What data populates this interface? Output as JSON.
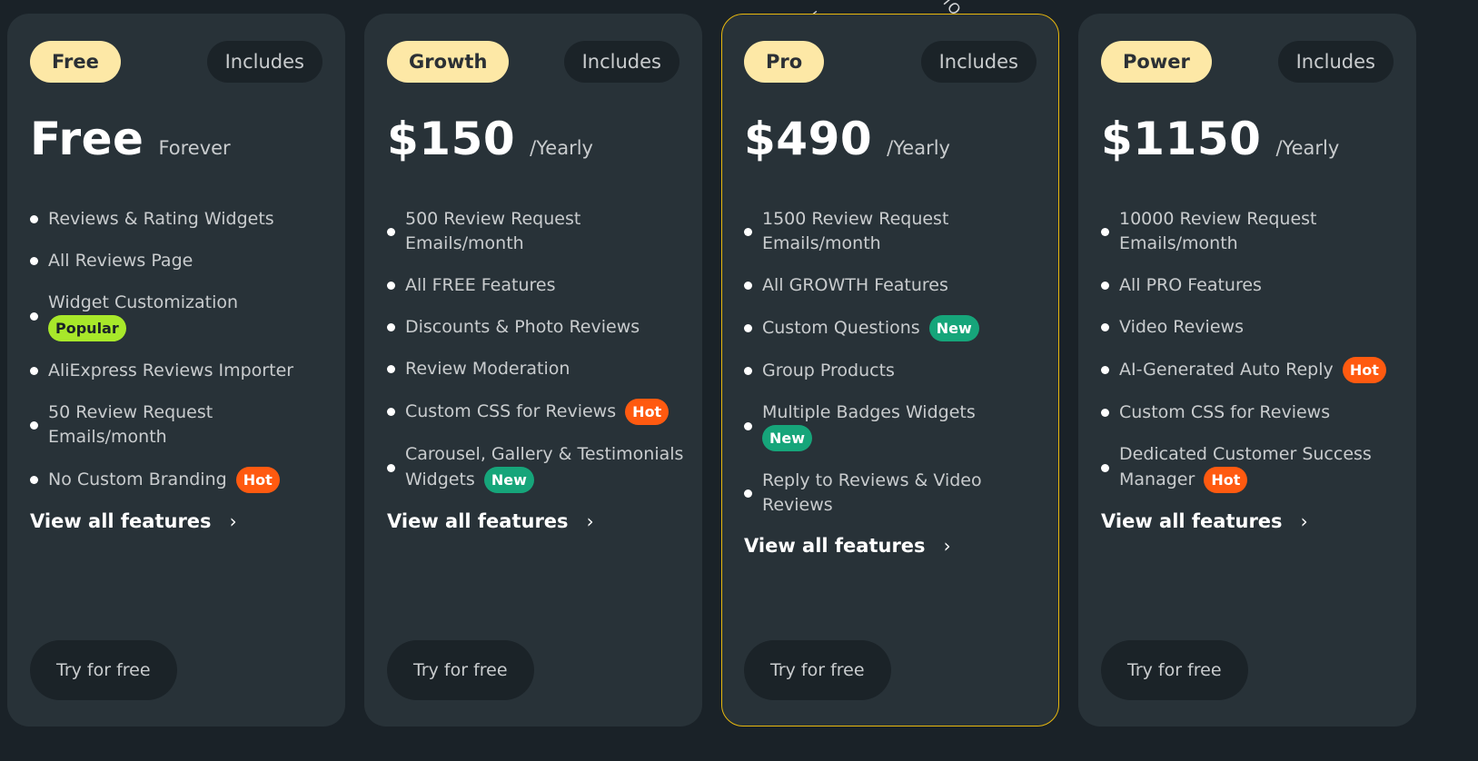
{
  "decor": {
    "arc_left": "T   ",
    "arc_right": "IO"
  },
  "colors": {
    "background": "#1a2228",
    "card": "#283238",
    "tier_badge": "#fde8a6",
    "featured_border": "#e8b80e",
    "tag_hot": "#ff5a10",
    "tag_new": "#16a57a",
    "tag_popular": "#a8e82a"
  },
  "plans": [
    {
      "tier": "Free",
      "includes_label": "Includes",
      "price": "Free",
      "period": "Forever",
      "featured": false,
      "features": [
        {
          "text": "Reviews & Rating Widgets",
          "tag": null
        },
        {
          "text": "All Reviews Page",
          "tag": null
        },
        {
          "text": "Widget Customization",
          "tag": "Popular"
        },
        {
          "text": "AliExpress Reviews Importer",
          "tag": null
        },
        {
          "text": "50 Review Request Emails/month",
          "tag": null
        },
        {
          "text": "No Custom Branding",
          "tag": "Hot"
        }
      ],
      "view_all_label": "View all features",
      "cta_label": "Try for free"
    },
    {
      "tier": "Growth",
      "includes_label": "Includes",
      "price": "$150",
      "period": "/Yearly",
      "featured": false,
      "features": [
        {
          "text": "500 Review Request Emails/month",
          "tag": null
        },
        {
          "text": "All FREE Features",
          "tag": null
        },
        {
          "text": "Discounts & Photo Reviews",
          "tag": null
        },
        {
          "text": "Review Moderation",
          "tag": null
        },
        {
          "text": "Custom CSS for Reviews",
          "tag": "Hot"
        },
        {
          "text": "Carousel, Gallery & Testimonials Widgets",
          "tag": "New"
        }
      ],
      "view_all_label": "View all features",
      "cta_label": "Try for free"
    },
    {
      "tier": "Pro",
      "includes_label": "Includes",
      "price": "$490",
      "period": "/Yearly",
      "featured": true,
      "features": [
        {
          "text": "1500 Review Request Emails/month",
          "tag": null
        },
        {
          "text": "All GROWTH Features",
          "tag": null
        },
        {
          "text": "Custom Questions",
          "tag": "New"
        },
        {
          "text": "Group Products",
          "tag": null
        },
        {
          "text": "Multiple Badges Widgets",
          "tag": "New"
        },
        {
          "text": "Reply to Reviews & Video Reviews",
          "tag": null
        }
      ],
      "view_all_label": "View all features",
      "cta_label": "Try for free"
    },
    {
      "tier": "Power",
      "includes_label": "Includes",
      "price": "$1150",
      "period": "/Yearly",
      "featured": false,
      "features": [
        {
          "text": "10000 Review Request Emails/month",
          "tag": null
        },
        {
          "text": "All PRO Features",
          "tag": null
        },
        {
          "text": "Video Reviews",
          "tag": null
        },
        {
          "text": "AI-Generated Auto Reply",
          "tag": "Hot"
        },
        {
          "text": "Custom CSS for Reviews",
          "tag": null
        },
        {
          "text": "Dedicated Customer Success Manager",
          "tag": "Hot"
        }
      ],
      "view_all_label": "View all features",
      "cta_label": "Try for free"
    }
  ]
}
